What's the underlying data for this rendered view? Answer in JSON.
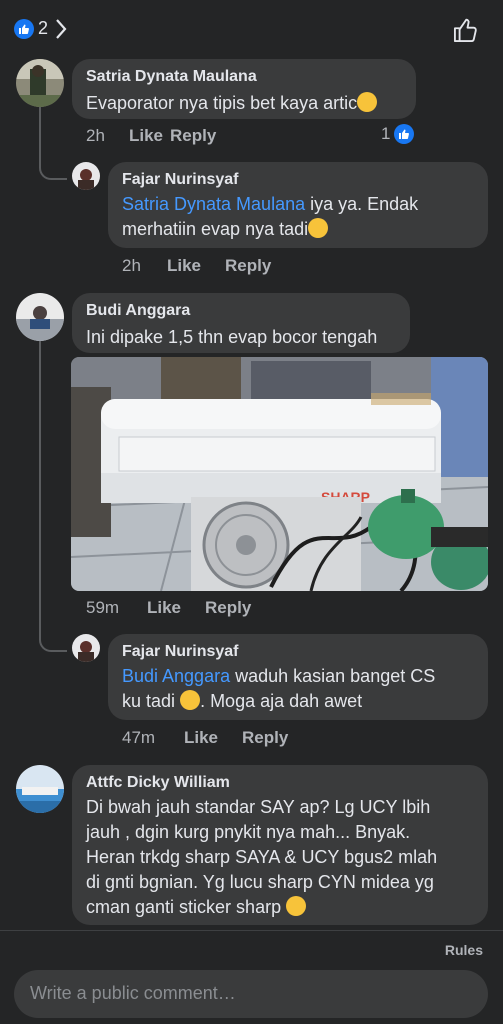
{
  "header": {
    "reaction_count": "2"
  },
  "comments": [
    {
      "author": "Satria Dynata Maulana",
      "text": "Evaporator nya tipis bet kaya artic",
      "time": "2h",
      "like": "Like",
      "reply": "Reply",
      "reactions": "1",
      "replies": [
        {
          "author": "Fajar Nurinsyaf",
          "mention": "Satria Dynata Maulana",
          "text_line1": " iya ya. Endak",
          "text_line2": "merhatiin evap nya tadi",
          "time": "2h",
          "like": "Like",
          "reply": "Reply"
        }
      ]
    },
    {
      "author": "Budi Anggara",
      "text": "Ini dipake 1,5 thn evap bocor tengah",
      "photo_brand": "SHARP",
      "time": "59m",
      "like": "Like",
      "reply": "Reply",
      "replies": [
        {
          "author": "Fajar Nurinsyaf",
          "mention": "Budi Anggara",
          "text_line1": " waduh kasian banget CS",
          "text_line2a": "ku tadi",
          "text_line2b": ". Moga aja dah awet",
          "time": "47m",
          "like": "Like",
          "reply": "Reply"
        }
      ]
    },
    {
      "author": "Attfc Dicky William",
      "lines": [
        "Di bwah jauh standar SAY ap? Lg UCY lbih",
        "jauh , dgin kurg pnykit nya mah... Bnyak.",
        "Heran trkdg sharp SAYA & UCY bgus2 mlah",
        "di gnti bgnian. Yg lucu sharp CYN midea yg",
        "cman ganti sticker sharp"
      ]
    }
  ],
  "footer": {
    "rules": "Rules",
    "placeholder": "Write a public comment…"
  },
  "colors": {
    "accent": "#1877f2",
    "mention": "#4599ff",
    "bubble": "#3a3b3c",
    "background": "#242526"
  }
}
